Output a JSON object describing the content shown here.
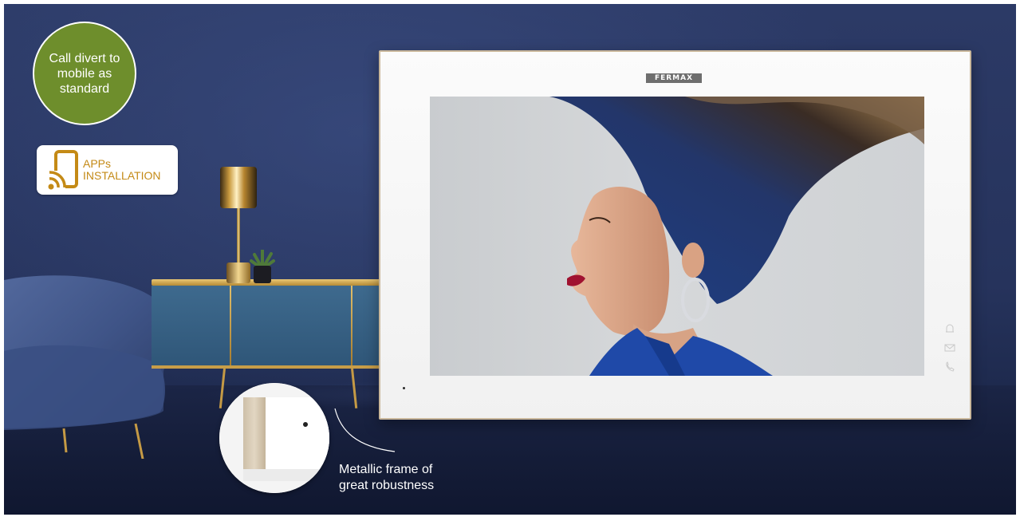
{
  "badges": {
    "call_divert": {
      "text": "Call divert to mobile as standard",
      "color": "#6e8e2c"
    },
    "apps_installation": {
      "line1": "APPs",
      "line2": "INSTALLATION",
      "color": "#c48a16",
      "icon": "mobile-wifi-icon"
    }
  },
  "monitor": {
    "brand": "FERMAX",
    "touch_keys": [
      "bell-icon",
      "mail-icon",
      "phone-icon"
    ],
    "frame_color": "#c9b79b"
  },
  "frame_detail": {
    "caption_line1": "Metallic frame of",
    "caption_line2": "great robustness"
  }
}
